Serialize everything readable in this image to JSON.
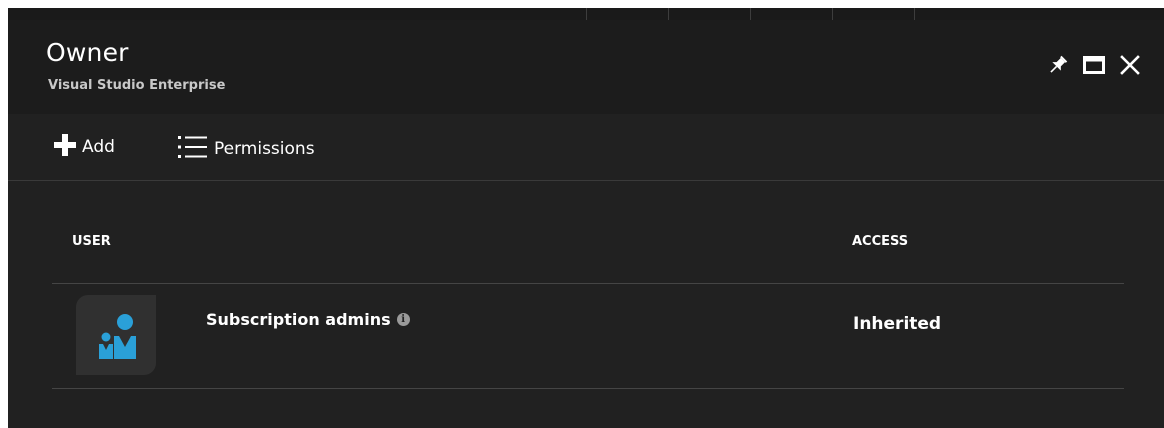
{
  "blade": {
    "title": "Owner",
    "subtitle": "Visual Studio Enterprise"
  },
  "window_controls": {
    "pin_icon": "pin-icon",
    "maximize_icon": "maximize-icon",
    "close_icon": "close-icon"
  },
  "toolbar": {
    "add_label": "Add",
    "add_icon": "plus-icon",
    "permissions_label": "Permissions",
    "permissions_icon": "list-icon"
  },
  "table": {
    "columns": [
      "USER",
      "ACCESS"
    ],
    "rows": [
      {
        "avatar_icon": "users-group-icon",
        "user": "Subscription admins",
        "info_icon": "info-icon",
        "access": "Inherited"
      }
    ]
  },
  "colors": {
    "background": "#212121",
    "header": "#1c1c1c",
    "text": "#ffffff",
    "subtle_text": "#c8c8c8",
    "avatar_accent": "#2aa0d8",
    "divider": "#454545"
  }
}
